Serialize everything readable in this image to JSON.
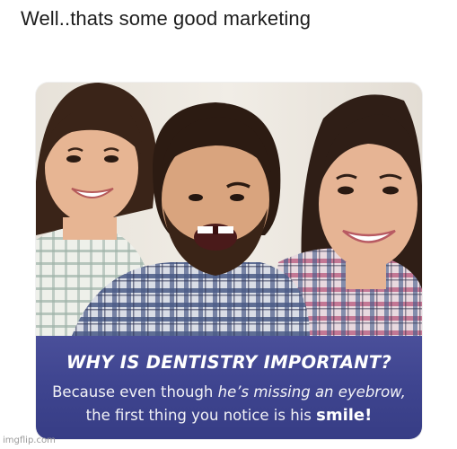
{
  "post": {
    "text": "Well..thats some good marketing"
  },
  "ad": {
    "headline": "WHY IS DENTISTRY IMPORTANT?",
    "line1_a": "Because even though ",
    "line1_b": "he’s missing an eyebrow,",
    "line2_a": "the first thing you notice is his ",
    "line2_b": "smile!"
  },
  "watermark": {
    "text": "imgflip.com"
  },
  "colors": {
    "caption_band": "#3f4590",
    "caption_text": "#ffffff"
  }
}
